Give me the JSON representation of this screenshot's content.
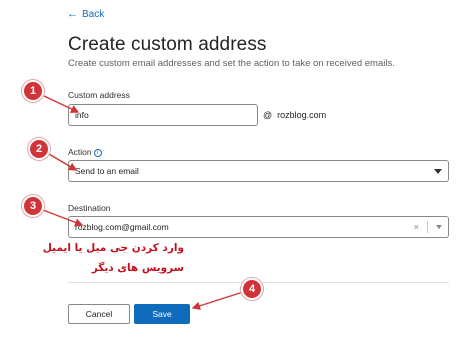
{
  "nav": {
    "back_label": "Back"
  },
  "page": {
    "title": "Create custom address",
    "subtitle": "Create custom email addresses and set the action to take on received emails."
  },
  "form": {
    "alias": {
      "label": "Custom address",
      "value": "info"
    },
    "domain": {
      "at": "@",
      "value": "rozblog.com"
    },
    "action": {
      "label": "Action",
      "info_icon": "ⓘ",
      "value": "Send to an email"
    },
    "destination": {
      "label": "Destination",
      "value": "rozblog.com@gmail.com",
      "clear_icon": "×"
    }
  },
  "buttons": {
    "cancel_label": "Cancel",
    "save_label": "Save"
  },
  "annotations": {
    "markers": [
      "1",
      "2",
      "3",
      "4"
    ],
    "note": "وارد کردن جی میل یا ایمیل سرویس های دیگر",
    "color": "#d13438"
  },
  "colors": {
    "accent": "#0f6cbd",
    "annotation": "#c50f1f"
  }
}
